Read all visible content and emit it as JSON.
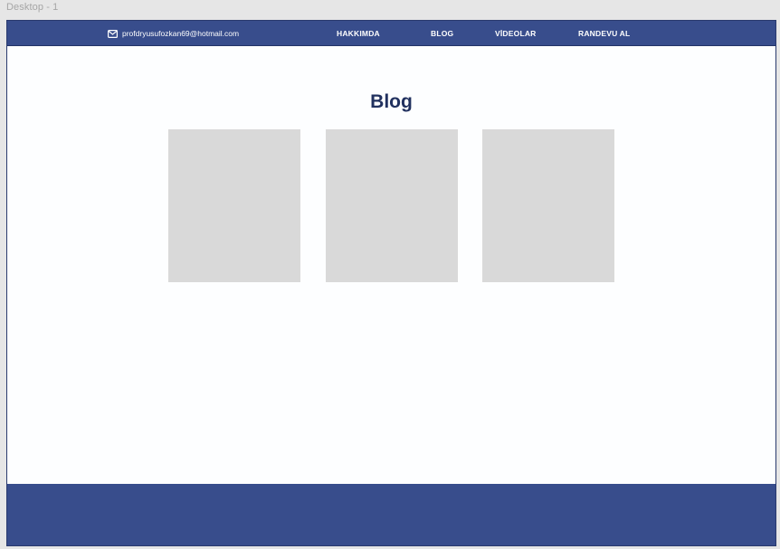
{
  "canvas": {
    "frame_label": "Desktop - 1"
  },
  "navbar": {
    "email": "profdryusufozkan69@hotmail.com",
    "email_icon": "mail-icon",
    "links": [
      {
        "label": "HAKKIMDA"
      },
      {
        "label": "BLOG"
      },
      {
        "label": "VİDEOLAR"
      },
      {
        "label": "RANDEVU AL"
      }
    ]
  },
  "main": {
    "title": "Blog"
  },
  "colors": {
    "brand": "#384d8c",
    "title": "#21315f",
    "card_placeholder": "#d9d9d9",
    "page_background": "#fdfeff"
  }
}
